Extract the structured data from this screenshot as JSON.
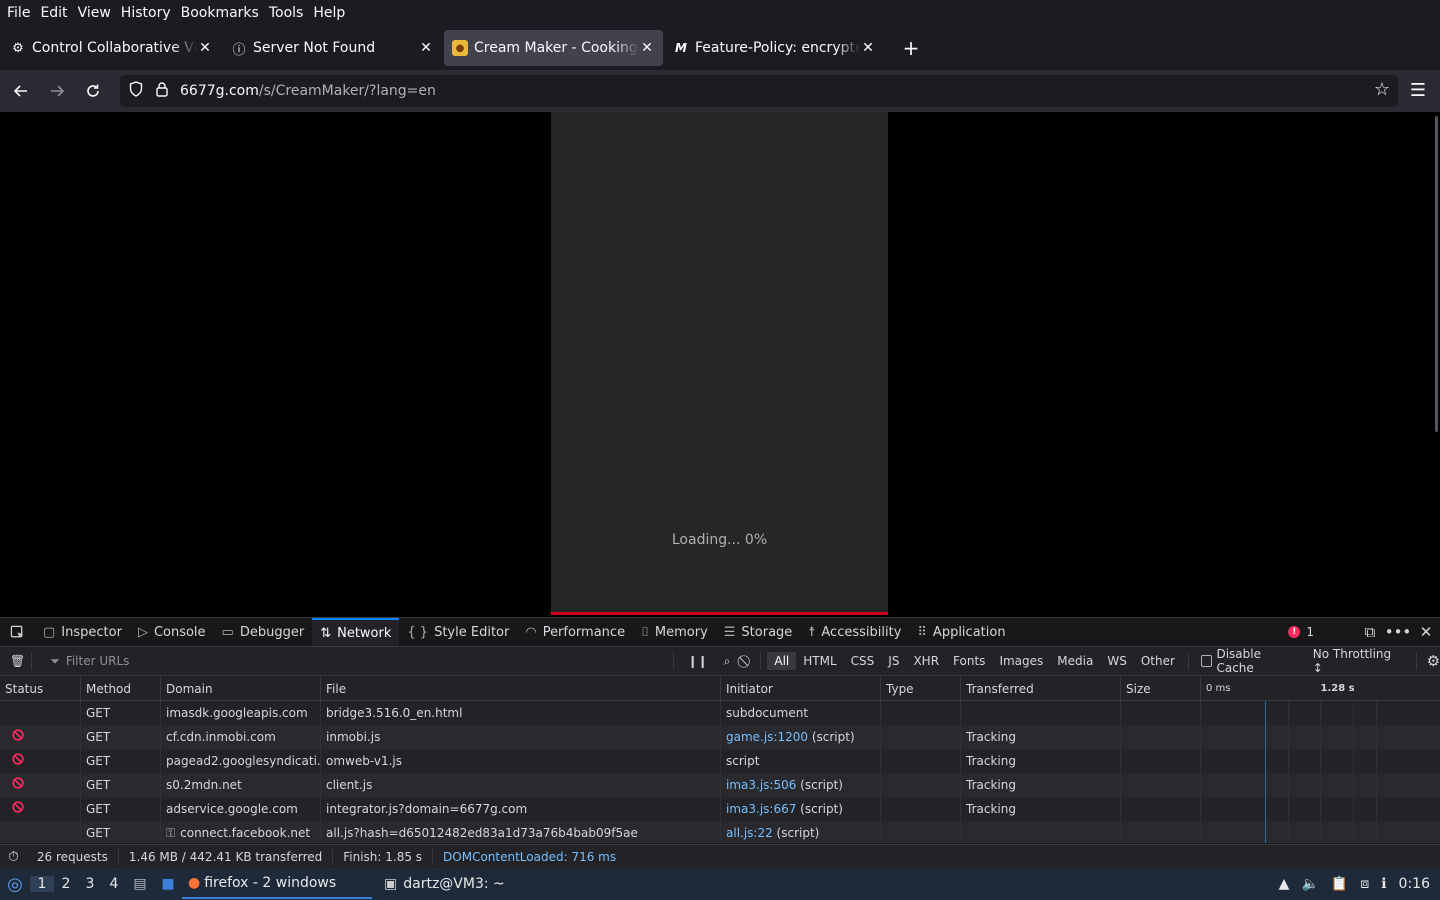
{
  "menu": [
    "File",
    "Edit",
    "View",
    "History",
    "Bookmarks",
    "Tools",
    "Help"
  ],
  "tabs": [
    {
      "title": "Control Collaborative Virt",
      "icon": "gear-icon",
      "active": false
    },
    {
      "title": "Server Not Found",
      "icon": "info-icon",
      "active": false
    },
    {
      "title": "Cream Maker - Cooking Gam",
      "icon": "game-favicon-icon",
      "active": true
    },
    {
      "title": "Feature-Policy: encrypted",
      "icon": "mdn-icon",
      "active": false
    }
  ],
  "url": {
    "domain": "6677g.com",
    "path": "/s/CreamMaker/?lang=en"
  },
  "page": {
    "loading_text": "Loading... 0%"
  },
  "devtools": {
    "tabs": [
      "Inspector",
      "Console",
      "Debugger",
      "Network",
      "Style Editor",
      "Performance",
      "Memory",
      "Storage",
      "Accessibility",
      "Application"
    ],
    "active_tab": "Network",
    "error_count": "1",
    "filter_placeholder": "Filter URLs",
    "type_filters": [
      "All",
      "HTML",
      "CSS",
      "JS",
      "XHR",
      "Fonts",
      "Images",
      "Media",
      "WS",
      "Other"
    ],
    "disable_cache_label": "Disable Cache",
    "throttling": "No Throttling ↕",
    "columns": [
      "Status",
      "Method",
      "Domain",
      "File",
      "Initiator",
      "Type",
      "Transferred",
      "Size"
    ],
    "waterfall_labels": [
      "0 ms",
      "1.28 s"
    ],
    "requests": [
      {
        "blocked": false,
        "method": "GET",
        "domain": "imasdk.googleapis.com",
        "file": "bridge3.516.0_en.html",
        "initiator_link": "",
        "initiator_text": "subdocument",
        "type": "",
        "transferred": "",
        "size": ""
      },
      {
        "blocked": true,
        "method": "GET",
        "domain": "cf.cdn.inmobi.com",
        "file": "inmobi.js",
        "initiator_link": "game.js:1200",
        "initiator_text": " (script)",
        "type": "",
        "transferred": "Tracking",
        "size": ""
      },
      {
        "blocked": true,
        "method": "GET",
        "domain": "pagead2.googlesyndicati...",
        "file": "omweb-v1.js",
        "initiator_link": "",
        "initiator_text": "script",
        "type": "",
        "transferred": "Tracking",
        "size": ""
      },
      {
        "blocked": true,
        "method": "GET",
        "domain": "s0.2mdn.net",
        "file": "client.js",
        "initiator_link": "ima3.js:506",
        "initiator_text": " (script)",
        "type": "",
        "transferred": "Tracking",
        "size": ""
      },
      {
        "blocked": true,
        "method": "GET",
        "domain": "adservice.google.com",
        "file": "integrator.js?domain=6677g.com",
        "initiator_link": "ima3.js:667",
        "initiator_text": " (script)",
        "type": "",
        "transferred": "Tracking",
        "size": ""
      },
      {
        "blocked": false,
        "method": "GET",
        "domain": "connect.facebook.net",
        "file": "all.js?hash=d65012482ed83a1d73a76b4bab09f5ae",
        "initiator_link": "all.js:22",
        "initiator_text": " (script)",
        "type": "",
        "transferred": "",
        "size": ""
      }
    ],
    "summary": {
      "requests": "26 requests",
      "transferred": "1.46 MB / 442.41 KB transferred",
      "finish": "Finish: 1.85 s",
      "dom": "DOMContentLoaded: 716 ms"
    }
  },
  "taskbar": {
    "workspaces": [
      "1",
      "2",
      "3",
      "4"
    ],
    "firefox_label": "firefox - 2 windows",
    "terminal_label": "dartz@VM3: ~",
    "clock": "0:16"
  },
  "colors": {
    "accent": "#0a84ff",
    "error": "#ff2a5f",
    "link": "#75bfff",
    "progress": "#d0021b"
  }
}
